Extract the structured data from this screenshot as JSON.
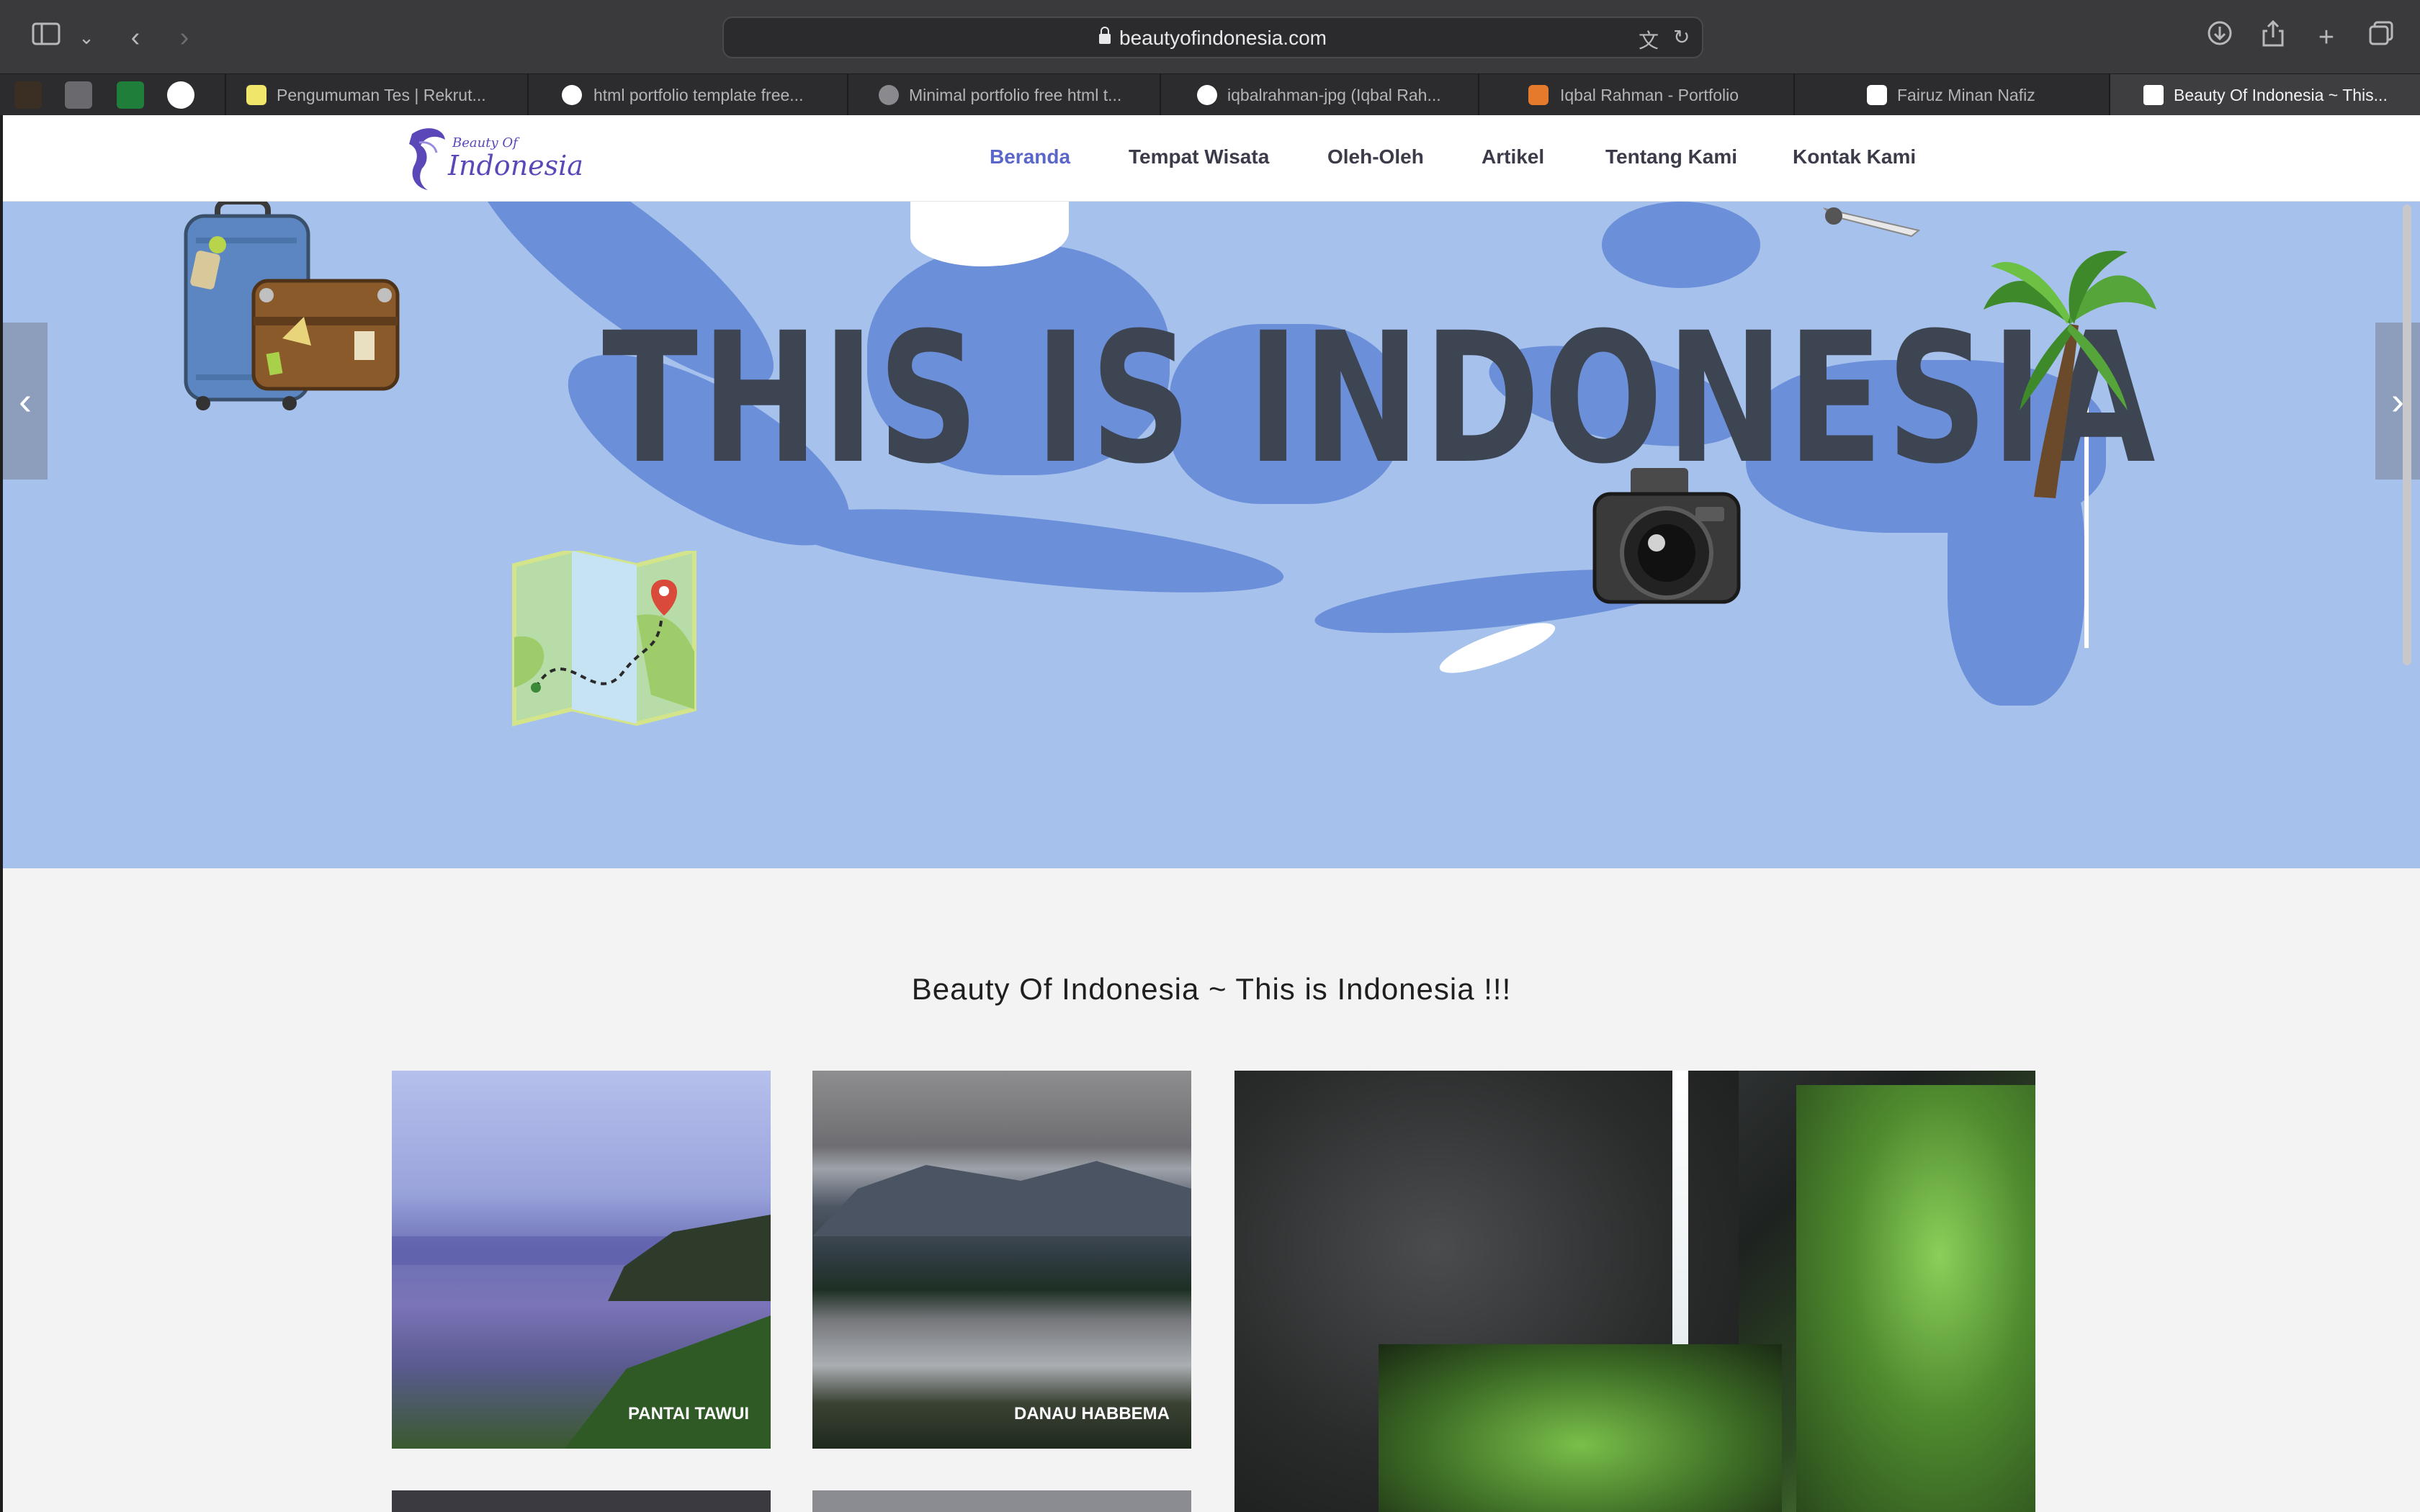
{
  "browser": {
    "url": "beautyofindonesia.com",
    "tabs": [
      {
        "title": "Pengumuman Tes | Rekrut..."
      },
      {
        "title": "html portfolio template free..."
      },
      {
        "title": "Minimal portfolio free html t..."
      },
      {
        "title": "iqbalrahman-jpg (Iqbal Rah..."
      },
      {
        "title": "Iqbal Rahman - Portfolio"
      },
      {
        "title": "Fairuz Minan Nafiz"
      },
      {
        "title": "Beauty Of Indonesia ~ This..."
      }
    ],
    "icons": [
      "sidebar-icon",
      "chevron-down-icon",
      "back-icon",
      "forward-icon",
      "translate-icon",
      "reload-icon",
      "download-icon",
      "share-icon",
      "new-tab-icon",
      "tabs-overview-icon"
    ]
  },
  "site": {
    "logo_small": "Beauty Of",
    "logo_big": "Indonesia",
    "nav": [
      "Beranda",
      "Tempat Wisata",
      "Oleh-Oleh",
      "Artikel",
      "Tentang Kami",
      "Kontak Kami"
    ],
    "active_nav": "Beranda",
    "hero_title": "THIS IS INDONESIA",
    "section_title": "Beauty Of Indonesia ~ This is Indonesia !!!",
    "tiles": [
      {
        "label": "PANTAI TAWUI"
      },
      {
        "label": "DANAU HABBEMA"
      },
      {
        "label": ""
      }
    ]
  }
}
